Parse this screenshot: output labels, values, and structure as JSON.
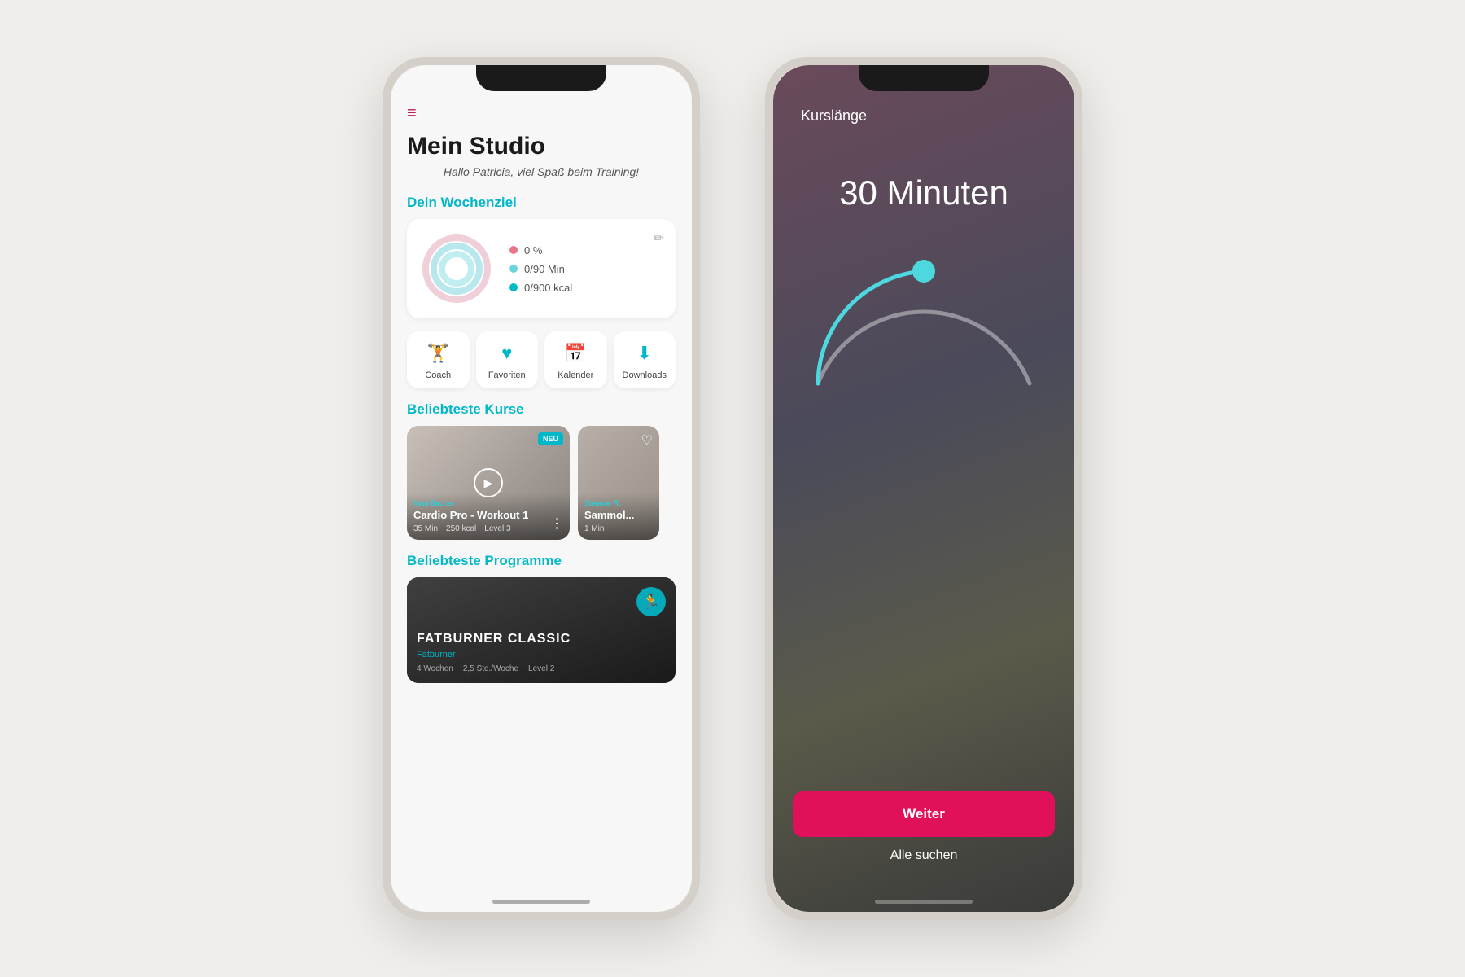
{
  "phone1": {
    "title": "Mein Studio",
    "greeting": "Hallo Patricia, viel Spaß beim Training!",
    "weeklyGoal": {
      "sectionTitle": "Dein Wochenziel",
      "stats": [
        {
          "label": "0 %",
          "color": "#e8758a"
        },
        {
          "label": "0/90 Min",
          "color": "#6ed4dc"
        },
        {
          "label": "0/900 kcal",
          "color": "#00b8c8"
        }
      ]
    },
    "quickActions": [
      {
        "label": "Coach",
        "icon": "🏋"
      },
      {
        "label": "Favoriten",
        "icon": "❤"
      },
      {
        "label": "Kalender",
        "icon": "📅"
      },
      {
        "label": "Downloads",
        "icon": "⬇"
      }
    ],
    "popularCourses": {
      "sectionTitle": "Beliebteste Kurse",
      "cards": [
        {
          "trainer": "Nina Bacher",
          "title": "Cardio Pro - Workout 1",
          "duration": "35 Min",
          "kcal": "250 kcal",
          "level": "Level 3",
          "isNew": true
        },
        {
          "trainer": "Stefanie R.",
          "title": "Sammol...",
          "duration": "1 Min",
          "isNew": false
        }
      ]
    },
    "popularPrograms": {
      "sectionTitle": "Beliebteste Programme",
      "cards": [
        {
          "title": "FATBURNER CLASSIC",
          "subtitle": "Fatburner",
          "weeks": "4 Wochen",
          "hoursPerWeek": "2,5 Std./Woche",
          "level": "Level 2"
        }
      ]
    }
  },
  "phone2": {
    "title": "Kurslänge",
    "duration": "30 Minuten",
    "sliderValue": 30,
    "buttons": {
      "weiter": "Weiter",
      "allesuchen": "Alle suchen"
    }
  },
  "icons": {
    "hamburger": "≡",
    "edit": "✏",
    "play": "▶",
    "heart": "♡",
    "heart_filled": "♥",
    "dots": "⋮",
    "coach": "🏋",
    "favorite": "❤",
    "calendar": "📅",
    "download": "⬇",
    "fatburner": "🏃"
  }
}
